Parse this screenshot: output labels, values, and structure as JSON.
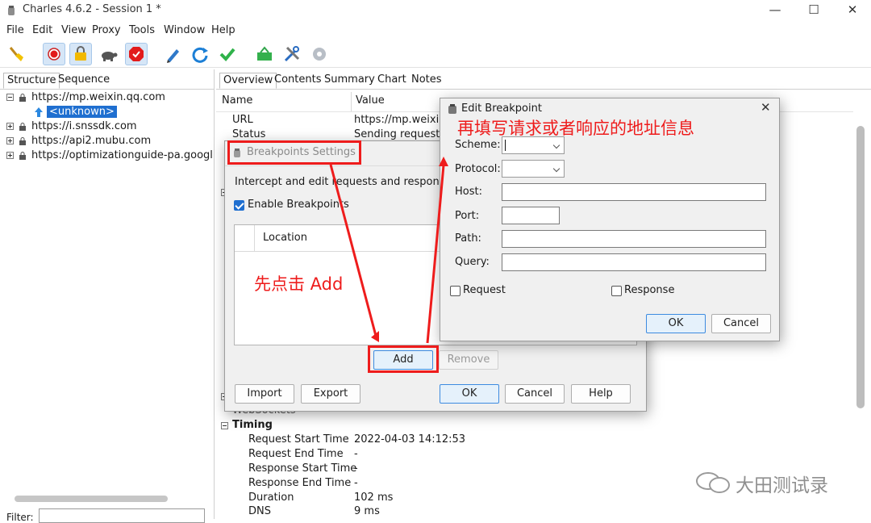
{
  "window": {
    "title": "Charles 4.6.2 - Session 1 *",
    "controls": [
      "—",
      "☐",
      "✕"
    ]
  },
  "menu": [
    "File",
    "Edit",
    "View",
    "Proxy",
    "Tools",
    "Window",
    "Help"
  ],
  "left": {
    "tabs": [
      "Structure",
      "Sequence"
    ],
    "tree": [
      {
        "label": "https://mp.weixin.qq.com",
        "expanded": true
      },
      {
        "label": "<unknown>",
        "child": true
      },
      {
        "label": "https://i.snssdk.com"
      },
      {
        "label": "https://api2.mubu.com"
      },
      {
        "label": "https://optimizationguide-pa.googlea"
      }
    ],
    "filter_label": "Filter:"
  },
  "right": {
    "tabs": [
      "Overview",
      "Contents",
      "Summary",
      "Chart",
      "Notes"
    ],
    "columns": [
      "Name",
      "Value"
    ],
    "rows_top": [
      {
        "name": "URL",
        "value": "https://mp.weixin.c"
      },
      {
        "name": "Status",
        "value": "Sending request b"
      }
    ],
    "websockets_label": "WebSockets",
    "timing_label": "Timing",
    "timing": [
      {
        "name": "Request Start Time",
        "value": "2022-04-03 14:12:53"
      },
      {
        "name": "Request End Time",
        "value": "-"
      },
      {
        "name": "Response Start Time",
        "value": "-"
      },
      {
        "name": "Response End Time",
        "value": "-"
      },
      {
        "name": "Duration",
        "value": "102 ms"
      },
      {
        "name": "DNS",
        "value": "9 ms"
      }
    ]
  },
  "breakpoints": {
    "title": "Breakpoints Settings",
    "intro": "Intercept and edit requests and responses be",
    "enable_label": "Enable Breakpoints",
    "location_header": "Location",
    "add": "Add",
    "remove": "Remove",
    "import": "Import",
    "export": "Export",
    "ok": "OK",
    "cancel": "Cancel",
    "help": "Help"
  },
  "edit": {
    "title": "Edit Breakpoint",
    "scheme": "Scheme:",
    "protocol": "Protocol:",
    "host": "Host:",
    "port": "Port:",
    "path": "Path:",
    "query": "Query:",
    "request": "Request",
    "response": "Response",
    "ok": "OK",
    "cancel": "Cancel"
  },
  "annotations": {
    "step1": "先点击 Add",
    "step2": "再填写请求或者响应的地址信息"
  },
  "watermark": "大田测试录",
  "colors": {
    "annotation": "#ee1c1c",
    "selection": "#1f6fd0"
  }
}
